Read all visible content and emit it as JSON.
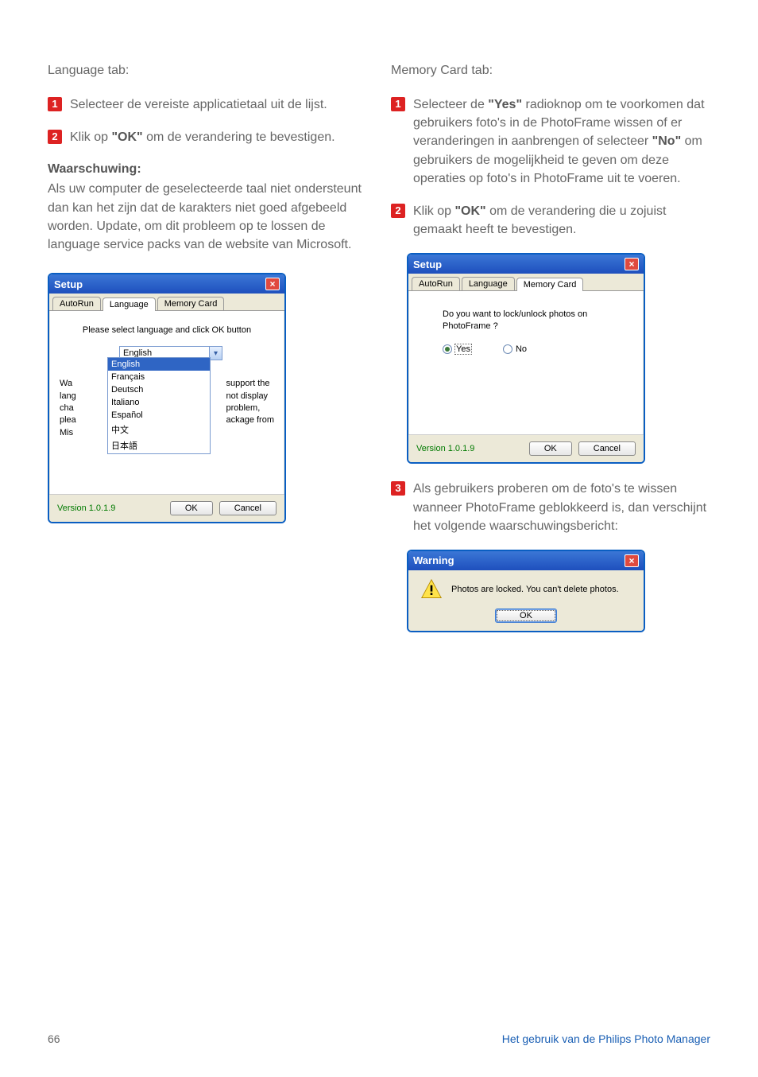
{
  "left": {
    "tab_title": "Language tab:",
    "steps": [
      {
        "num": "1",
        "text": "Selecteer de vereiste applicatietaal uit de lijst."
      },
      {
        "num": "2",
        "prefix": "Klik op ",
        "bold": "\"OK\"",
        "suffix": " om de verandering te bevestigen."
      }
    ],
    "warning_head": "Waarschuwing:",
    "warning_body": "Als uw computer de geselecteerde taal niet ondersteunt dan kan het zijn dat de karakters niet goed afgebeeld worden. Update, om dit probleem op te lossen de language service packs van de website van Microsoft."
  },
  "right": {
    "tab_title": "Memory Card tab:",
    "steps": [
      {
        "num": "1",
        "prefix": "Selecteer de ",
        "bold": "\"Yes\"",
        "suffix": " radioknop om te voorkomen dat gebruikers foto's in de PhotoFrame wissen of er veranderingen in aanbrengen of selecteer ",
        "bold2": "\"No\"",
        "suffix2": " om gebruikers de mogelijkheid te geven om deze operaties op foto's in PhotoFrame uit te voeren."
      },
      {
        "num": "2",
        "prefix": "Klik op ",
        "bold": "\"OK\"",
        "suffix": " om de verandering die u zojuist gemaakt heeft te bevestigen."
      },
      {
        "num": "3",
        "text": "Als gebruikers proberen om de foto's te wissen wanneer PhotoFrame geblokkeerd is, dan verschijnt het volgende waarschuwingsbericht:"
      }
    ]
  },
  "dialog": {
    "setup_title": "Setup",
    "tabs": {
      "autorun": "AutoRun",
      "language": "Language",
      "memorycard": "Memory Card"
    },
    "lang_prompt": "Please select language and click OK button",
    "selected_lang": "English",
    "lang_options": [
      "English",
      "Français",
      "Deutsch",
      "Italiano",
      "Español",
      "中文",
      "日本語"
    ],
    "cutoff_left": [
      "Wa",
      "lang",
      "cha",
      "plea",
      "Mis"
    ],
    "cutoff_right": [
      "support the",
      "not display",
      "problem,",
      "ackage from"
    ],
    "version": "Version 1.0.1.9",
    "ok": "OK",
    "cancel": "Cancel",
    "mem_question": "Do you want to lock/unlock photos on PhotoFrame ?",
    "yes": "Yes",
    "no": "No"
  },
  "warning_dialog": {
    "title": "Warning",
    "message": "Photos are locked. You can't delete photos.",
    "ok": "OK"
  },
  "footer": {
    "page": "66",
    "section": "Het gebruik van de Philips Photo Manager"
  }
}
